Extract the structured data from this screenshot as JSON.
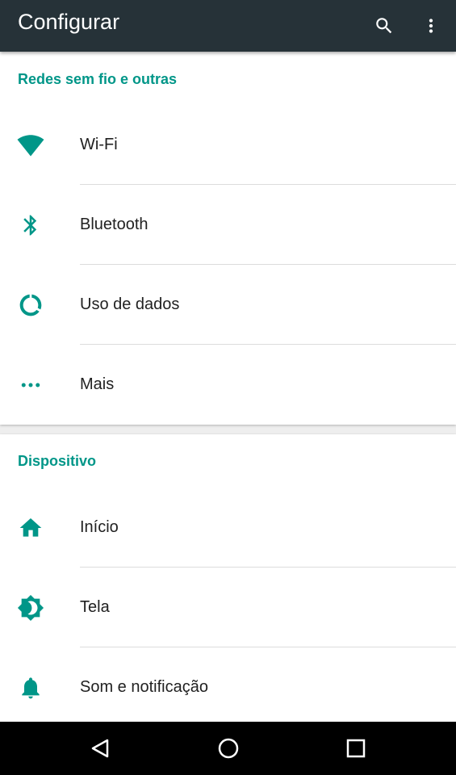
{
  "app_bar": {
    "title": "Configurar",
    "background": "#263238",
    "actions": [
      {
        "icon": "search-icon"
      },
      {
        "icon": "more-vert-icon"
      }
    ]
  },
  "accent_color": "#009688",
  "sections": [
    {
      "header": "Redes sem fio e outras",
      "items": [
        {
          "label": "Wi-Fi",
          "icon": "wifi-icon"
        },
        {
          "label": "Bluetooth",
          "icon": "bluetooth-icon"
        },
        {
          "label": "Uso de dados",
          "icon": "data-usage-icon"
        },
        {
          "label": "Mais",
          "icon": "more-horiz-icon"
        }
      ]
    },
    {
      "header": "Dispositivo",
      "items": [
        {
          "label": "Início",
          "icon": "home-icon"
        },
        {
          "label": "Tela",
          "icon": "brightness-icon"
        },
        {
          "label": "Som e notificação",
          "icon": "bell-icon"
        }
      ]
    }
  ],
  "nav_bar": {
    "buttons": [
      {
        "icon": "back-icon"
      },
      {
        "icon": "home-circle-icon"
      },
      {
        "icon": "recents-icon"
      }
    ]
  }
}
